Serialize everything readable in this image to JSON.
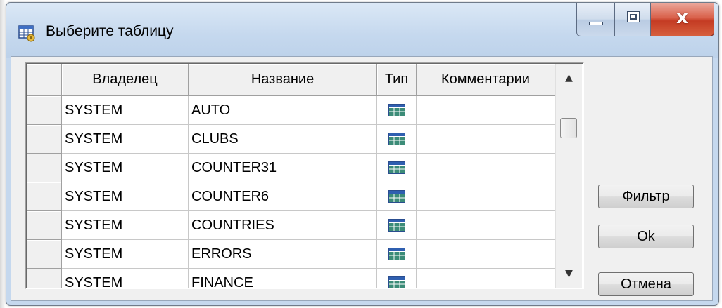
{
  "window": {
    "title": "Выберите таблицу",
    "icon": "table-grid-icon",
    "controls": {
      "minimize": "minimize-icon",
      "maximize": "maximize-icon",
      "close": "close-icon",
      "close_glyph": "x"
    }
  },
  "grid": {
    "columns": [
      "Владелец",
      "Название",
      "Тип",
      "Комментарии"
    ],
    "rows": [
      {
        "owner": "SYSTEM",
        "name": "AUTO",
        "type_icon": "table-icon",
        "comment": ""
      },
      {
        "owner": "SYSTEM",
        "name": "CLUBS",
        "type_icon": "table-icon",
        "comment": ""
      },
      {
        "owner": "SYSTEM",
        "name": "COUNTER31",
        "type_icon": "table-icon",
        "comment": ""
      },
      {
        "owner": "SYSTEM",
        "name": "COUNTER6",
        "type_icon": "table-icon",
        "comment": ""
      },
      {
        "owner": "SYSTEM",
        "name": "COUNTRIES",
        "type_icon": "table-icon",
        "comment": ""
      },
      {
        "owner": "SYSTEM",
        "name": "ERRORS",
        "type_icon": "table-icon",
        "comment": ""
      },
      {
        "owner": "SYSTEM",
        "name": "FINANCE",
        "type_icon": "table-icon",
        "comment": ""
      }
    ]
  },
  "buttons": {
    "filter": "Фильтр",
    "ok": "Ok",
    "cancel": "Отмена"
  },
  "colors": {
    "titlebar": "#c5d8ee",
    "client": "#f0f0f0",
    "close_button": "#c43b23",
    "table_icon_header": "#2f5fb0",
    "table_icon_cells": "#3c8c78"
  }
}
